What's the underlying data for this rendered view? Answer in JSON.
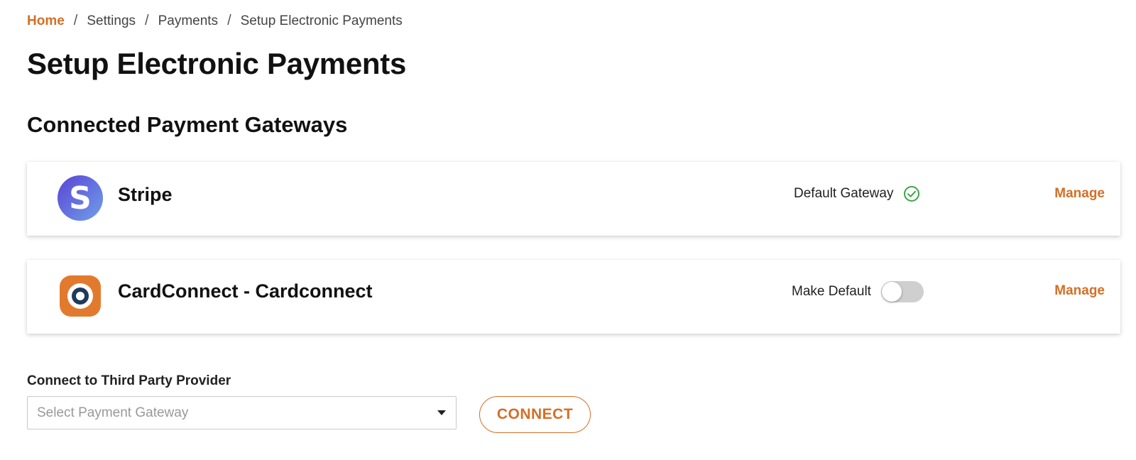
{
  "breadcrumb": {
    "items": [
      "Home",
      "Settings",
      "Payments",
      "Setup Electronic Payments"
    ],
    "separator": "/"
  },
  "page": {
    "title": "Setup Electronic Payments",
    "section_title": "Connected Payment Gateways"
  },
  "gateways": [
    {
      "name": "Stripe",
      "logo_icon": "stripe-logo-icon",
      "status_label": "Default Gateway",
      "status_icon": "check-circle-icon",
      "is_default": true,
      "manage_label": "Manage"
    },
    {
      "name": "CardConnect - Cardconnect",
      "logo_icon": "cardconnect-logo-icon",
      "status_label": "Make Default",
      "toggle_on": false,
      "manage_label": "Manage"
    }
  ],
  "connect": {
    "label": "Connect to Third Party Provider",
    "select_placeholder": "Select Payment Gateway",
    "button_label": "CONNECT"
  },
  "colors": {
    "accent": "#d46f26",
    "success": "#3aa845",
    "toggle_off": "#cfcfcf"
  }
}
